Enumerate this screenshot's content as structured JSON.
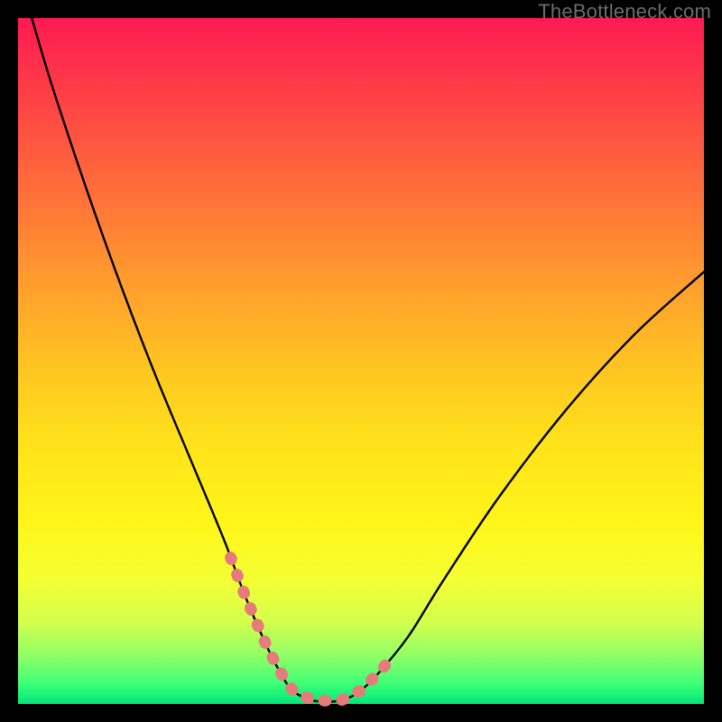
{
  "watermark": "TheBottleneck.com",
  "colors": {
    "frame": "#000000",
    "curve_stroke": "#000000",
    "accent_stroke": "#e77b7b",
    "gradient_top": "#ff1a52",
    "gradient_bottom": "#00e77a"
  },
  "chart_data": {
    "type": "line",
    "title": "",
    "xlabel": "",
    "ylabel": "",
    "xlim": [
      0,
      100
    ],
    "ylim": [
      0,
      100
    ],
    "grid": false,
    "series": [
      {
        "name": "bottleneck-curve",
        "x": [
          2,
          5,
          10,
          15,
          20,
          25,
          30,
          33,
          36,
          38,
          40,
          43,
          47,
          50,
          53,
          57,
          62,
          70,
          80,
          90,
          100
        ],
        "y": [
          100,
          90,
          75,
          61,
          48,
          36,
          24,
          16,
          9,
          5,
          2,
          0.5,
          0.5,
          2,
          5,
          10,
          18,
          30,
          43,
          54,
          63
        ]
      }
    ],
    "accent_segment": {
      "name": "valley-highlight",
      "x_range": [
        31,
        54
      ],
      "style": "thick-dotted"
    }
  }
}
